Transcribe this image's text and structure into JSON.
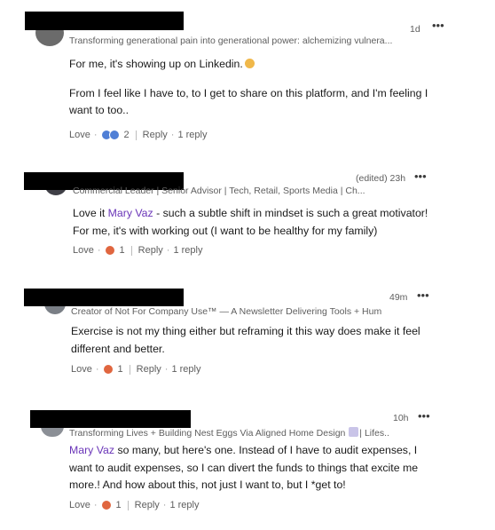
{
  "comments": [
    {
      "headline": "Transforming generational pain into generational power: alchemizing vulnera...",
      "time": "1d",
      "body": {
        "line1": "For me, it's showing up on Linkedin.",
        "para2": "From I feel like I have to, to I get to share on this platform, and I'm feeling I want to too.."
      },
      "react_label": "Love",
      "react_count": "2",
      "reply_label": "Reply",
      "reply_count": "1 reply"
    },
    {
      "headline": "Commercial Leader | Senior Advisor | Tech, Retail, Sports Media | Ch...",
      "time": "(edited) 23h",
      "body": {
        "pre": "Love it ",
        "mention": "Mary Vaz",
        "post": " - such a subtle shift in mindset is such a great motivator! For me, it's with working out (I want to be healthy for my family)"
      },
      "react_label": "Love",
      "react_count": "1",
      "reply_label": "Reply",
      "reply_count": "1 reply"
    },
    {
      "headline": "Creator of Not For Company Use™ — A Newsletter Delivering Tools + Hum...",
      "time": "49m",
      "body": {
        "text": "Exercise is not my thing either but reframing it this way does make it feel different and better."
      },
      "react_label": "Love",
      "react_count": "1",
      "reply_label": "Reply",
      "reply_count": "1 reply"
    },
    {
      "headline_pre": "Transforming Lives + Building Nest Eggs Via Aligned Home Design",
      "headline_post": "| Lifes...",
      "time": "10h",
      "body": {
        "mention": "Mary Vaz",
        "post": " so many, but here's one. Instead of I have to audit expenses, I want to audit expenses, so I can divert the funds to things that excite me more.! And how about this, not just I want to, but I *get to!"
      },
      "react_label": "Love",
      "react_count": "1",
      "reply_label": "Reply",
      "reply_count": "1 reply"
    }
  ],
  "more_icon": "more-horizontal-icon",
  "colors": {
    "mention": "#6a35b8",
    "bubble": "#f2f2f2",
    "love": "#e0663f",
    "support": "#4f7fd6"
  }
}
